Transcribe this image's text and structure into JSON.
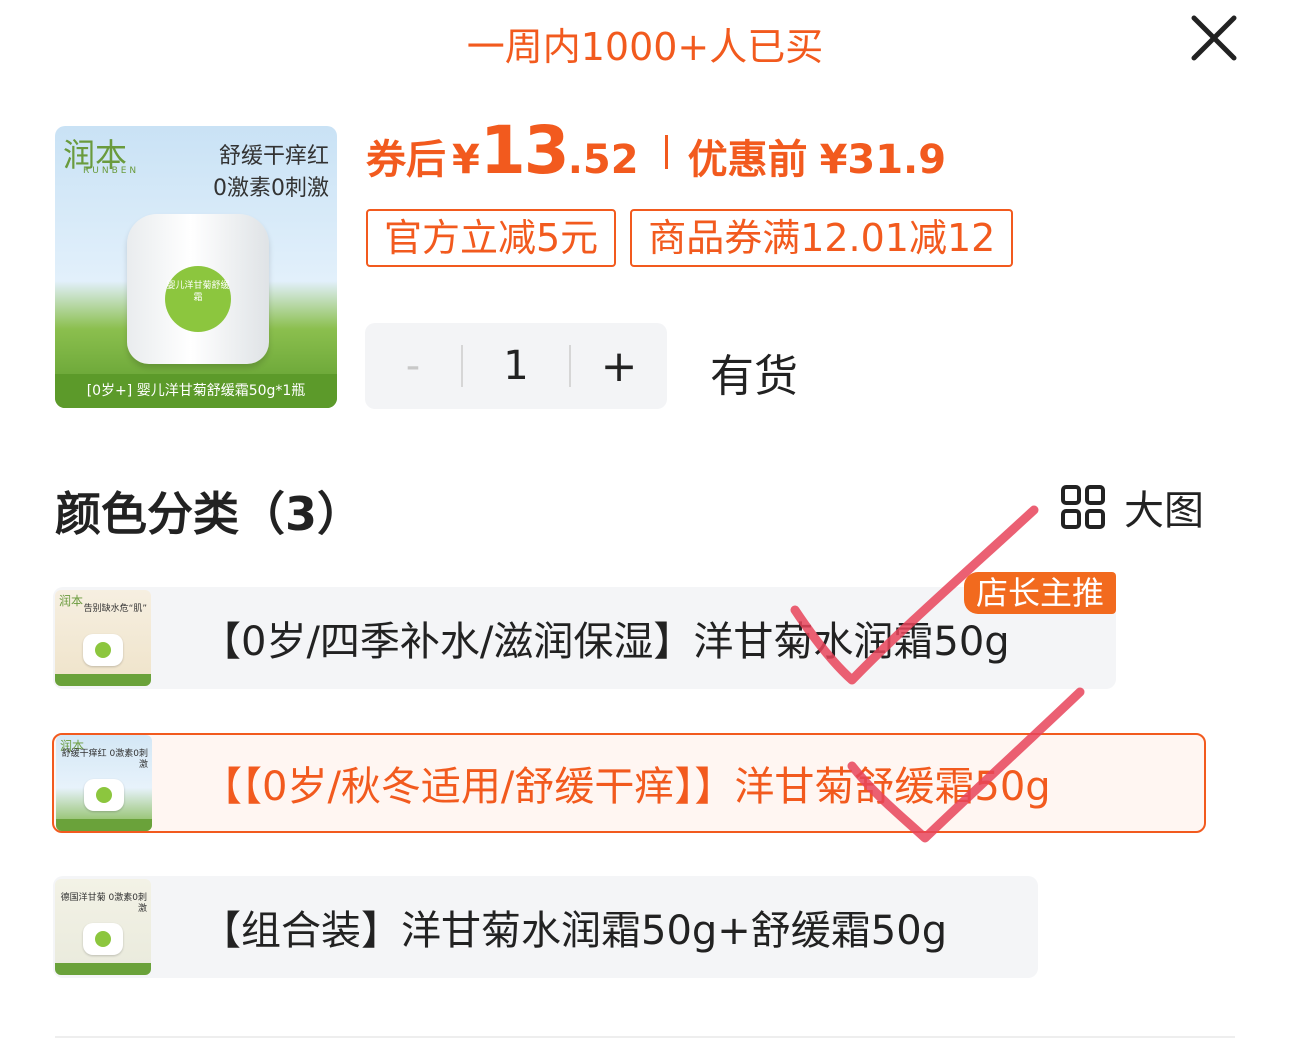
{
  "banner": {
    "sold_text": "一周内1000+人已买"
  },
  "product": {
    "thumb": {
      "brand": "润本",
      "brand_en": "RUNBEN",
      "slogan_line1": "舒缓干痒红",
      "slogan_line2": "0激素0刺激",
      "jar_label": "婴儿洋甘菊舒缓霜",
      "caption": "[0岁+] 婴儿洋甘菊舒缓霜50g*1瓶"
    },
    "price": {
      "prefix": "券后",
      "currency": "¥",
      "integer": "13",
      "decimal": ".52",
      "original_label": "优惠前",
      "original_value": "¥31.9"
    },
    "tags": [
      "官方立减5元",
      "商品券满12.01减12"
    ],
    "quantity": {
      "minus": "-",
      "value": "1",
      "plus": "+"
    },
    "stock": "有货"
  },
  "variants_section": {
    "title": "颜色分类（3）",
    "big_image_label": "大图",
    "badge": "店长主推",
    "items": [
      {
        "label": "【0岁/四季补水/滋润保湿】洋甘菊水润霜50g",
        "thumb_brand": "润本",
        "thumb_text": "告别缺水危“肌”",
        "selected": false
      },
      {
        "label": "【【0岁/秋冬适用/舒缓干痒】】洋甘菊舒缓霜50g",
        "thumb_brand": "润本",
        "thumb_text": "舒缓干痒红 0激素0刺激",
        "selected": true
      },
      {
        "label": "【组合装】洋甘菊水润霜50g+舒缓霜50g",
        "thumb_brand": "",
        "thumb_text": "德国洋甘菊 0激素0刺激",
        "selected": false
      }
    ]
  },
  "icons": {
    "close": "close-icon",
    "grid": "grid-icon"
  },
  "colors": {
    "accent": "#f25a1e",
    "check_mark": "#e8445a",
    "brand_green": "#6a9b3d"
  }
}
